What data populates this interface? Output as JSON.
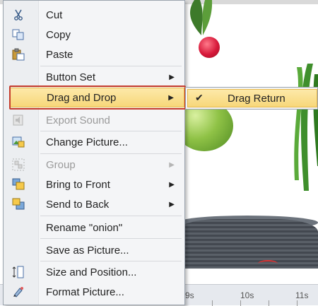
{
  "menu": {
    "items": [
      {
        "label": "Cut",
        "icon": "scissors-icon"
      },
      {
        "label": "Copy",
        "icon": "copy-icon"
      },
      {
        "label": "Paste",
        "icon": "paste-icon"
      },
      {
        "label": "Button Set",
        "icon": ""
      },
      {
        "label": "Drag and Drop",
        "icon": ""
      },
      {
        "label": "Export Sound",
        "icon": "export-sound-icon"
      },
      {
        "label": "Change Picture...",
        "icon": "change-picture-icon"
      },
      {
        "label": "Group",
        "icon": "group-icon"
      },
      {
        "label": "Bring to Front",
        "icon": "bring-to-front-icon"
      },
      {
        "label": "Send to Back",
        "icon": "send-to-back-icon"
      },
      {
        "label": "Rename \"onion\"",
        "icon": ""
      },
      {
        "label": "Save as Picture...",
        "icon": ""
      },
      {
        "label": "Size and Position...",
        "icon": "size-position-icon"
      },
      {
        "label": "Format Picture...",
        "icon": "format-picture-icon"
      }
    ]
  },
  "submenu": {
    "item": {
      "label": "Drag Return",
      "checked": "✔"
    }
  },
  "timeline": {
    "labels": [
      "9s",
      "10s",
      "11s"
    ]
  },
  "colors": {
    "highlight": "#f7d77a",
    "focus_border": "#c43a2a"
  }
}
